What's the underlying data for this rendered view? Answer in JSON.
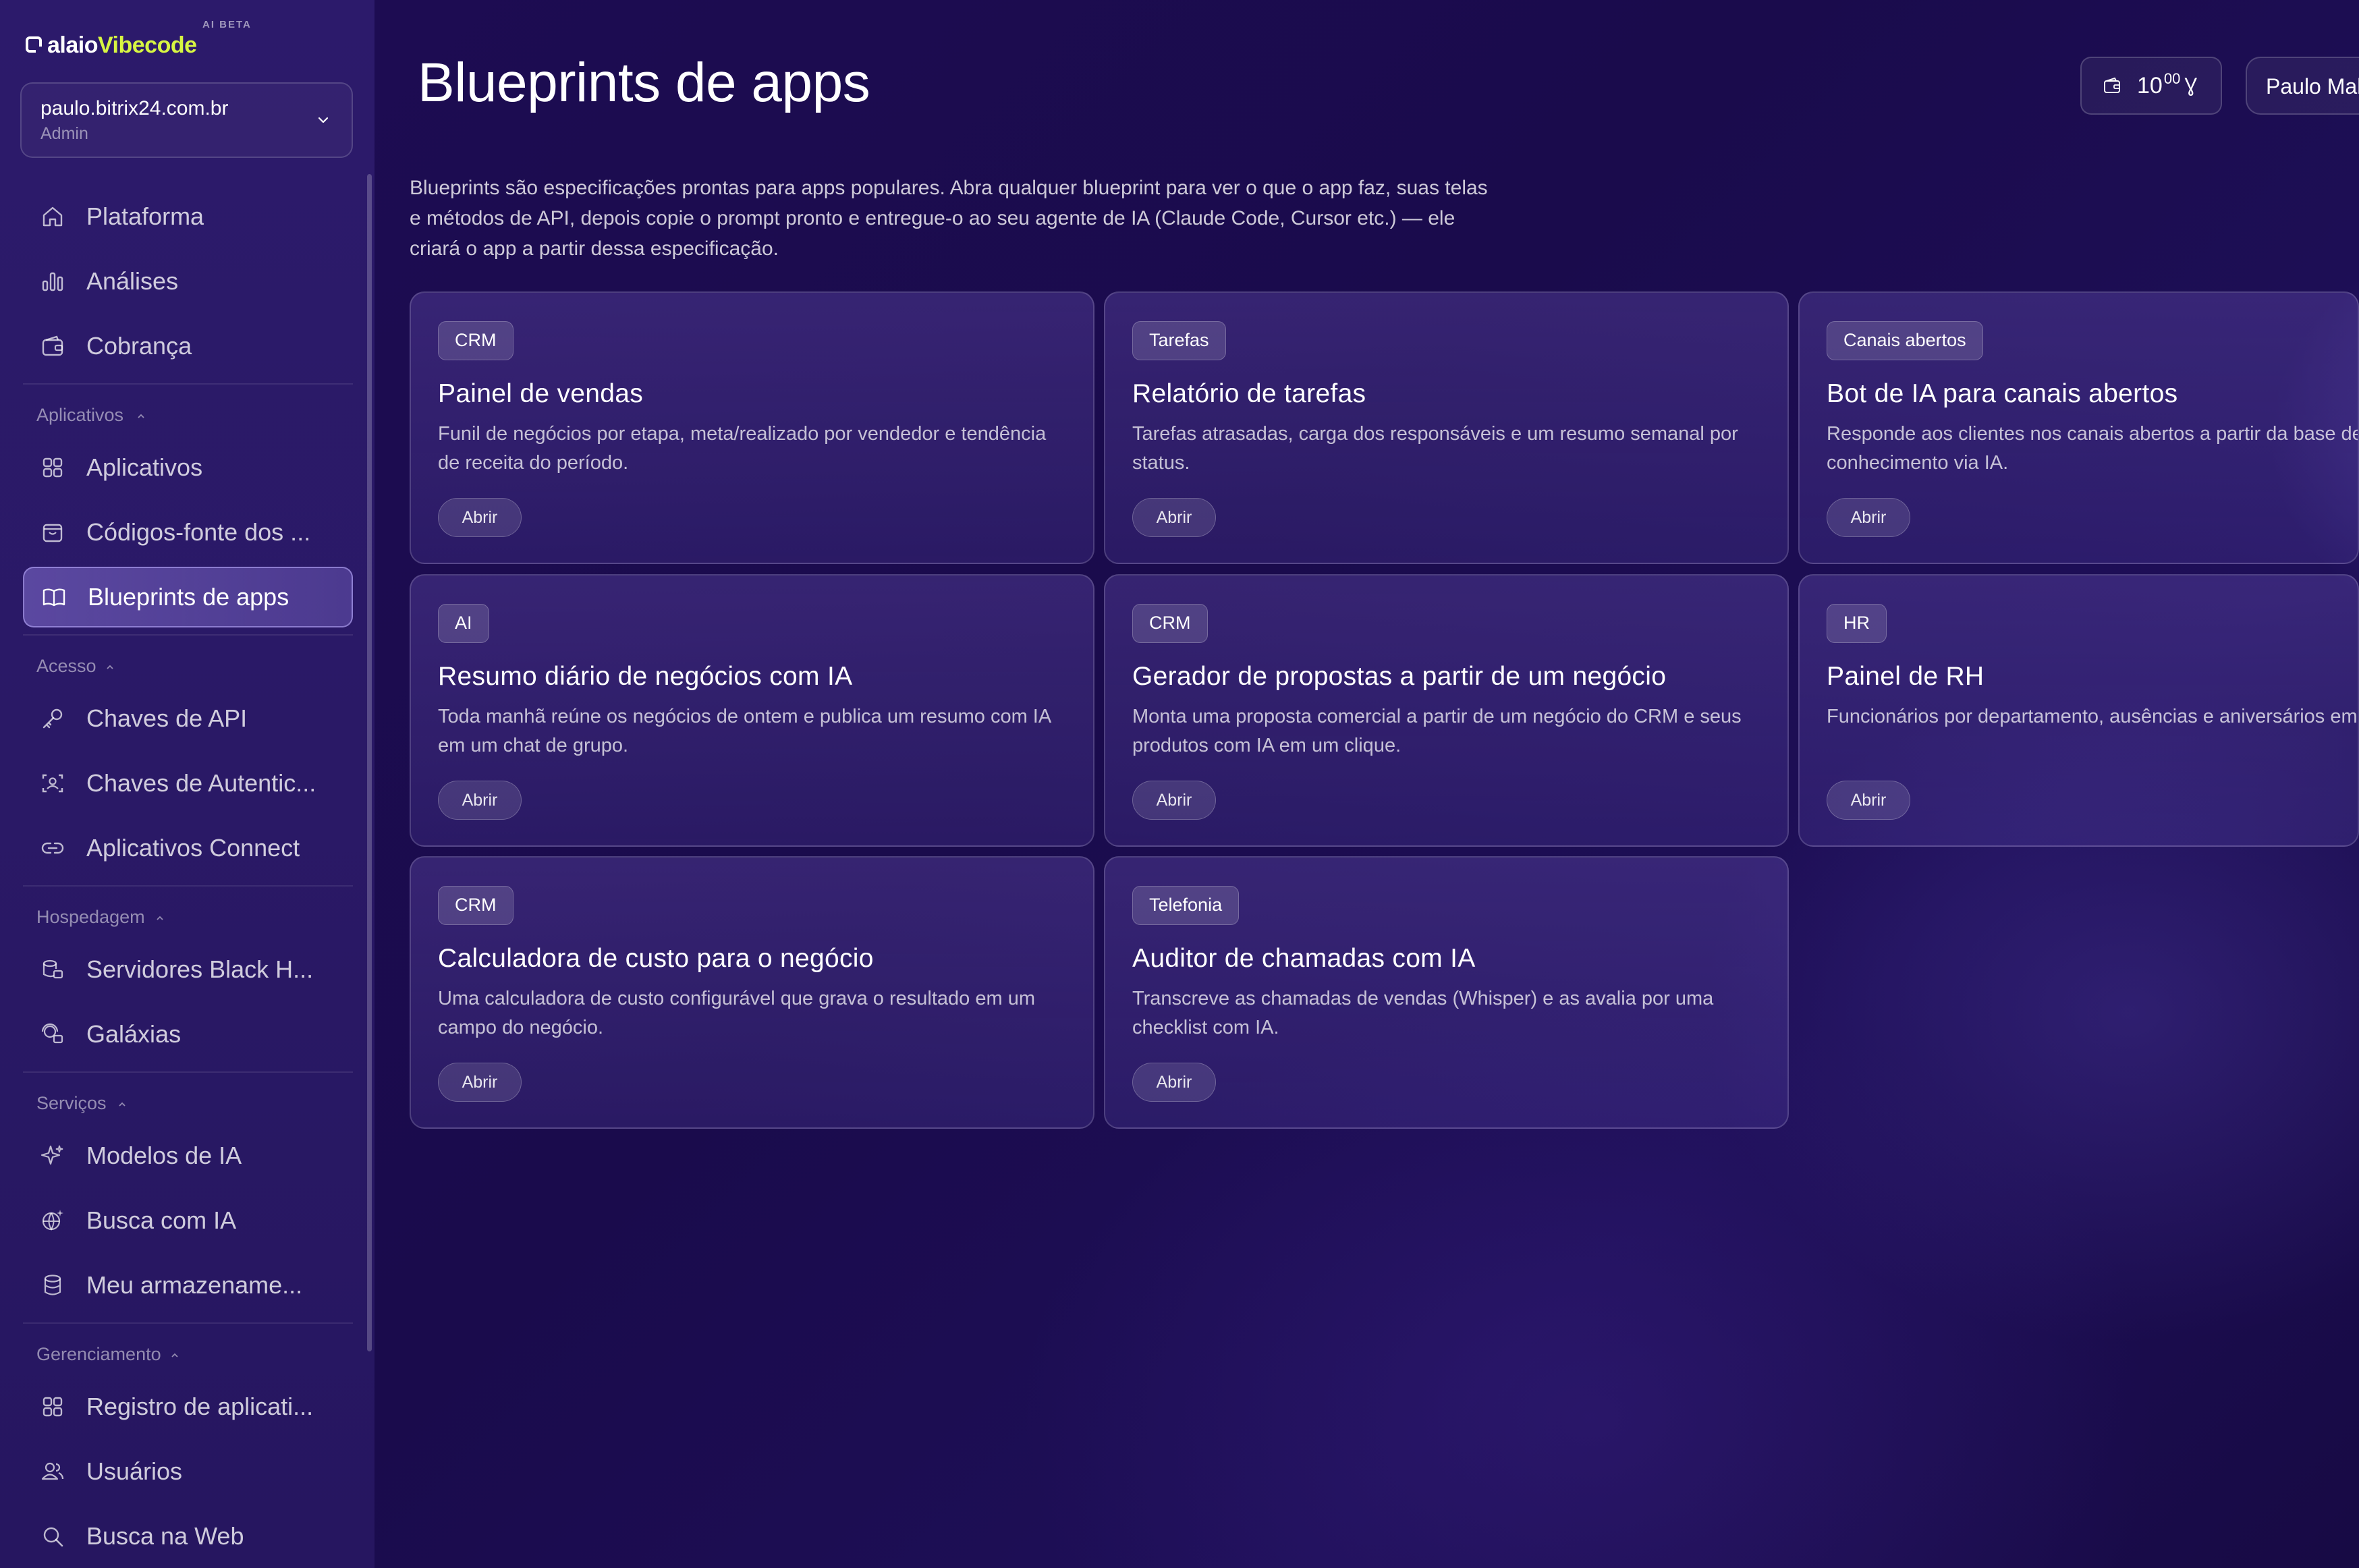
{
  "brand": {
    "name_part1": "alaio",
    "name_part2": "Vibecode",
    "beta": "AI BETA"
  },
  "account": {
    "email": "paulo.bitrix24.com.br",
    "role": "Admin"
  },
  "nav": {
    "top": [
      {
        "label": "Plataforma",
        "icon": "home-icon"
      },
      {
        "label": "Análises",
        "icon": "bar-chart-icon"
      },
      {
        "label": "Cobrança",
        "icon": "wallet-icon"
      }
    ],
    "sections": [
      {
        "label": "Aplicativos",
        "items": [
          {
            "label": "Aplicativos",
            "icon": "grid-icon"
          },
          {
            "label": "Códigos-fonte dos ...",
            "icon": "bag-icon"
          },
          {
            "label": "Blueprints de apps",
            "icon": "book-icon",
            "active": true
          }
        ]
      },
      {
        "label": "Acesso",
        "items": [
          {
            "label": "Chaves de API",
            "icon": "key-icon"
          },
          {
            "label": "Chaves de Autentic...",
            "icon": "user-scan-icon"
          },
          {
            "label": "Aplicativos Connect",
            "icon": "link-icon"
          }
        ]
      },
      {
        "label": "Hospedagem",
        "items": [
          {
            "label": "Servidores Black H...",
            "icon": "server-icon"
          },
          {
            "label": "Galáxias",
            "icon": "galaxy-icon"
          }
        ]
      },
      {
        "label": "Serviços",
        "items": [
          {
            "label": "Modelos de IA",
            "icon": "sparkle-icon"
          },
          {
            "label": "Busca com IA",
            "icon": "globe-sparkle-icon"
          },
          {
            "label": "Meu armazename...",
            "icon": "database-icon"
          }
        ]
      },
      {
        "label": "Gerenciamento",
        "items": [
          {
            "label": "Registro de aplicati...",
            "icon": "grid-icon"
          },
          {
            "label": "Usuários",
            "icon": "users-icon"
          },
          {
            "label": "Busca na Web",
            "icon": "search-icon"
          }
        ]
      }
    ]
  },
  "header": {
    "title": "Blueprints de apps",
    "credits": {
      "integer": "10",
      "decimal": "00",
      "symbol": "Ɣ"
    },
    "user": "Paulo Mal"
  },
  "intro": "Blueprints são especificações prontas para apps populares. Abra qualquer blueprint para ver o que o app faz, suas telas e métodos de API, depois copie o prompt pronto e entregue-o ao seu agente de IA (Claude Code, Cursor etc.) — ele criará o app a partir dessa especificação.",
  "cards": [
    {
      "tag": "CRM",
      "title": "Painel de vendas",
      "desc": "Funil de negócios por etapa, meta/realizado por vendedor e tendência de receita do período.",
      "button": "Abrir"
    },
    {
      "tag": "Tarefas",
      "title": "Relatório de tarefas",
      "desc": "Tarefas atrasadas, carga dos responsáveis e um resumo semanal por status.",
      "button": "Abrir"
    },
    {
      "tag": "Canais abertos",
      "title": "Bot de IA para canais abertos",
      "desc": "Responde aos clientes nos canais abertos a partir da base de conhecimento via IA.",
      "button": "Abrir"
    },
    {
      "tag": "AI",
      "title": "Resumo diário de negócios com IA",
      "desc": "Toda manhã reúne os negócios de ontem e publica um resumo com IA em um chat de grupo.",
      "button": "Abrir"
    },
    {
      "tag": "CRM",
      "title": "Gerador de propostas a partir de um negócio",
      "desc": "Monta uma proposta comercial a partir de um negócio do CRM e seus produtos com IA em um clique.",
      "button": "Abrir"
    },
    {
      "tag": "HR",
      "title": "Painel de RH",
      "desc": "Funcionários por departamento, ausências e aniversários em",
      "button": "Abrir"
    },
    {
      "tag": "CRM",
      "title": "Calculadora de custo para o negócio",
      "desc": "Uma calculadora de custo configurável que grava o resultado em um campo do negócio.",
      "button": "Abrir"
    },
    {
      "tag": "Telefonia",
      "title": "Auditor de chamadas com IA",
      "desc": "Transcreve as chamadas de vendas (Whisper) e as avalia por uma checklist com IA.",
      "button": "Abrir"
    }
  ]
}
